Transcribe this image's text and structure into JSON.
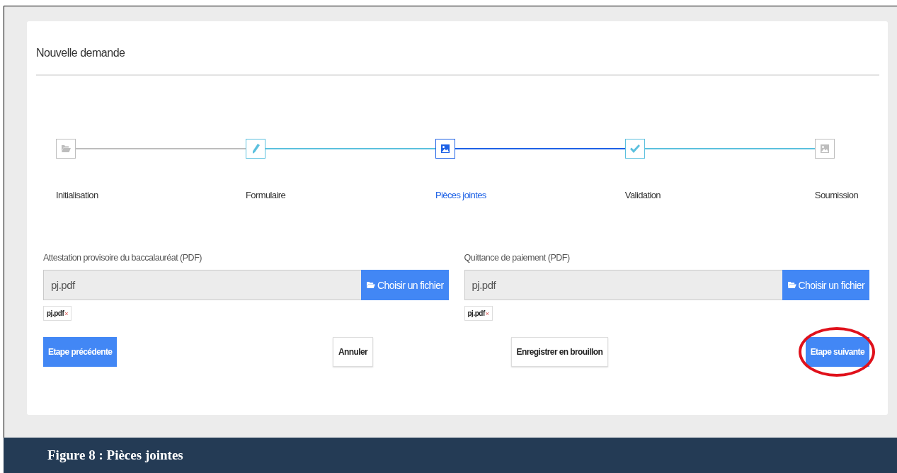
{
  "panel": {
    "title": "Nouvelle demande"
  },
  "steps": [
    {
      "label": "Initialisation",
      "kind": "folder",
      "completed": false,
      "selected": false
    },
    {
      "label": "Formulaire",
      "kind": "pencil",
      "completed": true,
      "selected": false
    },
    {
      "label": "Pièces jointes",
      "kind": "image",
      "completed": false,
      "selected": true
    },
    {
      "label": "Validation",
      "kind": "check",
      "completed": true,
      "selected": false
    },
    {
      "label": "Soumission",
      "kind": "image",
      "completed": false,
      "selected": false
    }
  ],
  "uploads": [
    {
      "label": "Attestation provisoire du baccalauréat (PDF)",
      "value": "pj.pdf",
      "button": "Choisir un fichier",
      "chip": "pj.pdf",
      "chip_remove": "×"
    },
    {
      "label": "Quittance de paiement (PDF)",
      "value": "pj.pdf",
      "button": "Choisir un fichier",
      "chip": "pj.pdf",
      "chip_remove": "×"
    }
  ],
  "actions": [
    {
      "label": "Etape précédente",
      "kind": "primary",
      "highlighted": false
    },
    {
      "label": "Annuler",
      "kind": "default",
      "highlighted": false
    },
    {
      "label": "Enregistrer en brouillon",
      "kind": "default",
      "highlighted": false
    },
    {
      "label": "Etape suivante",
      "kind": "primary",
      "highlighted": true
    }
  ],
  "caption": "Figure 8 : Pièces jointes"
}
